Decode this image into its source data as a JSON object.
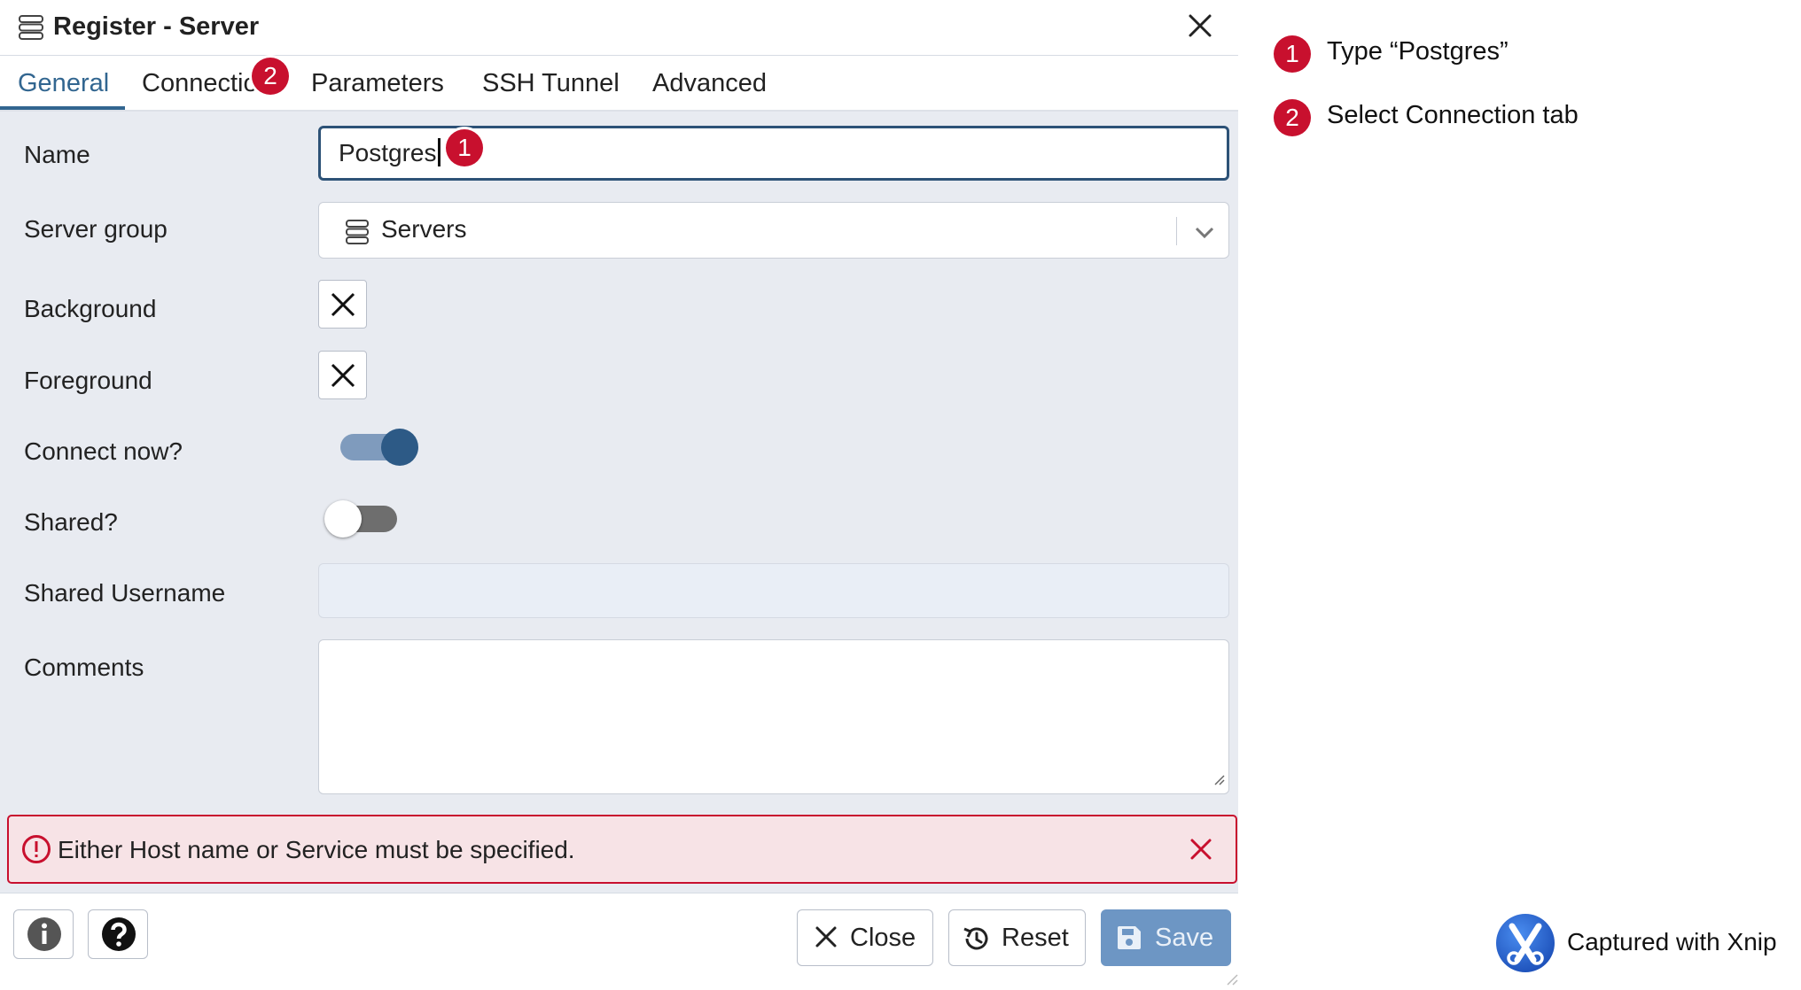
{
  "dialog": {
    "title": "Register - Server",
    "tabs": [
      {
        "label": "General"
      },
      {
        "label": "Connection"
      },
      {
        "label": "Parameters"
      },
      {
        "label": "SSH Tunnel"
      },
      {
        "label": "Advanced"
      }
    ],
    "active_tab": "General",
    "fields": {
      "name": {
        "label": "Name",
        "value": "Postgres"
      },
      "server_group": {
        "label": "Server group",
        "value": "Servers"
      },
      "background": {
        "label": "Background"
      },
      "foreground": {
        "label": "Foreground"
      },
      "connect_now": {
        "label": "Connect now?",
        "state": "on"
      },
      "shared": {
        "label": "Shared?",
        "state": "off"
      },
      "shared_username": {
        "label": "Shared Username",
        "value": ""
      },
      "comments": {
        "label": "Comments",
        "value": ""
      }
    },
    "error_message": "Either Host name or Service must be specified.",
    "buttons": {
      "info": "info-icon",
      "help": "help-icon",
      "close": "Close",
      "reset": "Reset",
      "save": "Save"
    }
  },
  "annotations": [
    {
      "number": "1",
      "text": "Type “Postgres”"
    },
    {
      "number": "2",
      "text": "Select Connection tab"
    }
  ],
  "watermark": "Captured with Xnip",
  "colors": {
    "accent": "#326690",
    "badge": "#c8102e",
    "error_bg": "#f7e3e6",
    "dialog_bg": "#e8ebf1",
    "save_button": "#6d96c4"
  }
}
